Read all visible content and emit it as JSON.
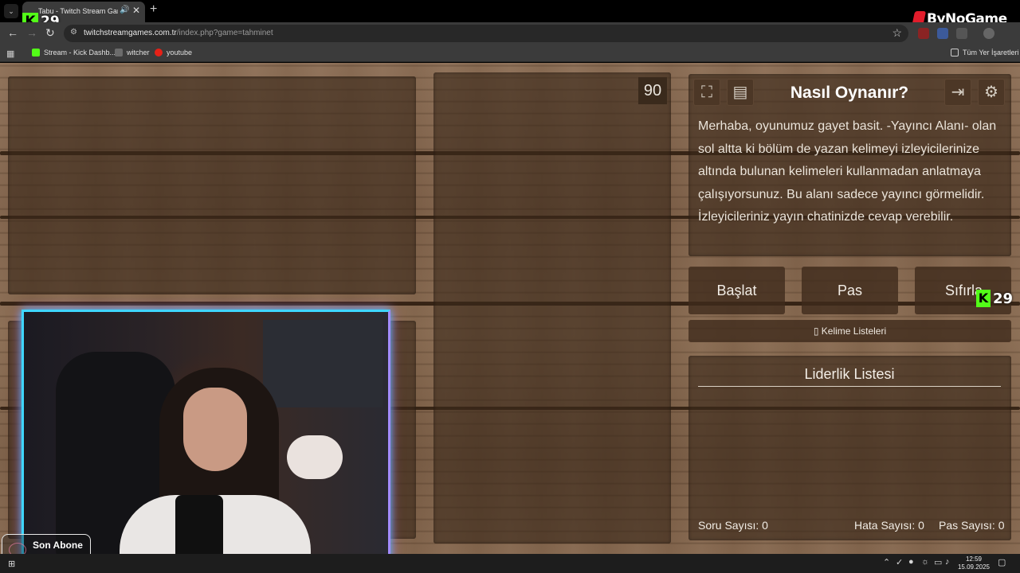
{
  "browser": {
    "tab_title": "Tabu - Twitch Stream Games",
    "audio_icon": "speaker-icon",
    "close_glyph": "✕",
    "new_tab_glyph": "+",
    "url_host": "twitchstreamgames.com.tr",
    "url_path": "/index.php?game=tahminet",
    "bookmarks": [
      {
        "label": "Stream - Kick Dashb...",
        "color": "#53fc18"
      },
      {
        "label": "witcher",
        "color": "#6b6b6b"
      },
      {
        "label": "youtube",
        "color": "#e62117"
      }
    ],
    "all_bookmarks_label": "Tüm Yer İşaretleri"
  },
  "overlay": {
    "kick_count_top": "29",
    "kick_count_right": "29",
    "brand_name": "ByNoGame",
    "sub_label": "Son Abone olabilir"
  },
  "game": {
    "timer": "90",
    "how_title": "Nasıl Oynanır?",
    "how_text": "Merhaba, oyunumuz gayet basit. -Yayıncı Alanı- olan sol altta ki bölüm de yazan kelimeyi izleyicilerinize altında bulunan kelimeleri kullanmadan anlatmaya çalışıyorsunuz. Bu alanı sadece yayıncı görmelidir. İzleyicileriniz yayın chatinizde cevap verebilir.",
    "buttons": {
      "start": "Başlat",
      "pass": "Pas",
      "reset": "Sıfırla"
    },
    "word_lists_label": "Kelime Listeleri",
    "leaderboard_title": "Liderlik Listesi",
    "stats": {
      "questions_label": "Soru Sayısı:",
      "questions_value": "0",
      "errors_label": "Hata Sayısı:",
      "errors_value": "0",
      "passes_label": "Pas Sayısı:",
      "passes_value": "0"
    }
  },
  "taskbar": {
    "time": "12:59",
    "date": "15.09.2025"
  },
  "colors": {
    "wood": "#86684f",
    "kick_green": "#53fc18",
    "cam_border_cyan": "#3fd6ff",
    "cam_border_pink": "#ff33d2"
  }
}
